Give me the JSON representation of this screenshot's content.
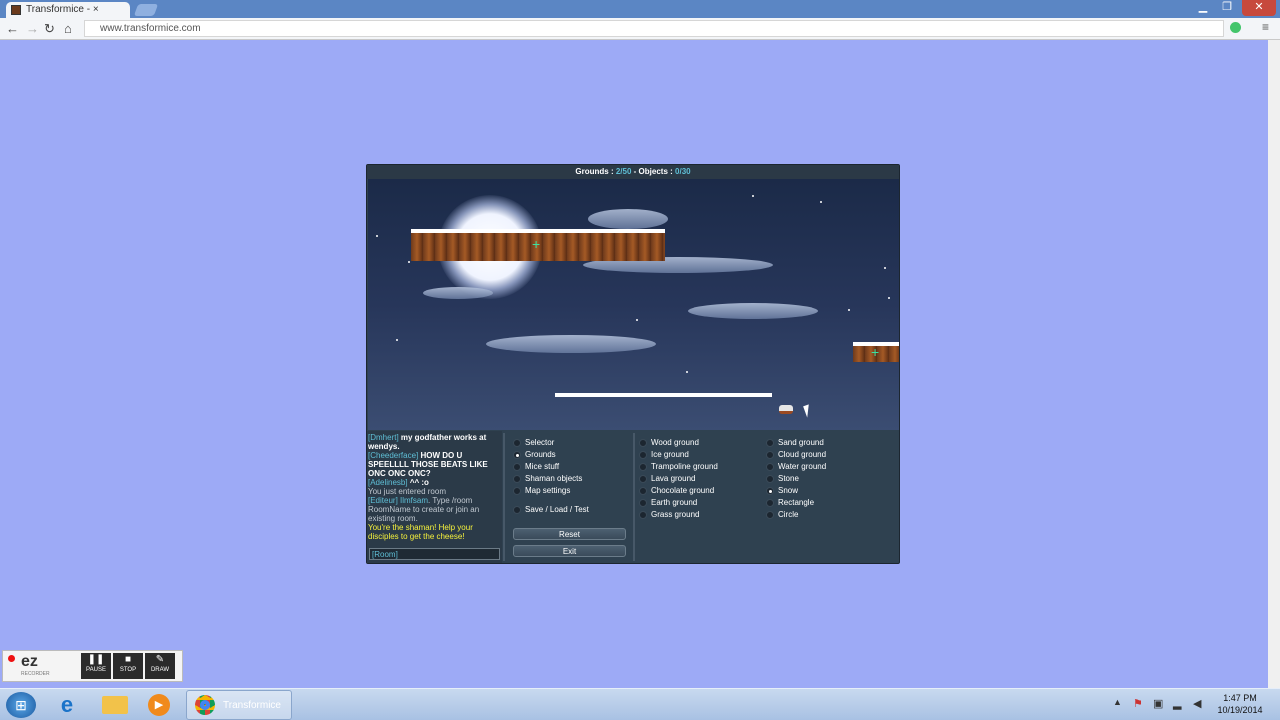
{
  "browser": {
    "tab_title": "Transformice - ×",
    "tab_close": "×",
    "url": "www.transformice.com",
    "window_min": "▁",
    "window_max": "❐",
    "window_close": "✕",
    "nav_back": "←",
    "nav_forward": "→",
    "nav_reload": "↻",
    "nav_home": "⌂",
    "menu_icon": "≡"
  },
  "game": {
    "hud": {
      "grounds_label": "Grounds :",
      "grounds_value": "2/50",
      "separator": " - ",
      "objects_label": "Objects :",
      "objects_value": "0/30"
    },
    "chat": {
      "lines": [
        {
          "nick": "[Dmhert]",
          "text": " my godfather works at wendys."
        },
        {
          "nick": "[Cheederface]",
          "text": " HOW DO U SPEELLLL THOSE BEATS LIKE ONC ONC ONC?"
        },
        {
          "nick": "[Adelinesb]",
          "text": " ^^ :o"
        }
      ],
      "system_1": "You just entered room",
      "system_2_nick": "[Editeur] Ilmfsam",
      "system_2_text": ". Type /room RoomName to create or join an existing room.",
      "shaman_msg": "You're the shaman! Help your disciples to get the cheese!",
      "input_prefix": "[Room]"
    },
    "menu": {
      "options": [
        "Selector",
        "Grounds",
        "Mice stuff",
        "Shaman objects",
        "Map settings"
      ],
      "selected": "Grounds",
      "save_label": "Save / Load / Test",
      "reset_label": "Reset",
      "exit_label": "Exit"
    },
    "grounds_col1": [
      "Wood ground",
      "Ice ground",
      "Trampoline ground",
      "Lava ground",
      "Chocolate ground",
      "Earth ground",
      "Grass ground"
    ],
    "grounds_col2": [
      "Sand ground",
      "Cloud ground",
      "Water ground",
      "Stone",
      "Snow",
      "Rectangle",
      "Circle"
    ],
    "selected_ground": "Snow"
  },
  "recorder": {
    "logo": "ez",
    "subtitle": "RECORDER",
    "pause": "PAUSE",
    "stop": "STOP",
    "draw": "DRAW"
  },
  "taskbar": {
    "active_window": "Transformice",
    "time": "1:47 PM",
    "date": "10/19/2014"
  },
  "colors": {
    "page_bg": "#9daaf6",
    "accent_cyan": "#5fbfd6",
    "shaman_yellow": "#f6f23c"
  }
}
